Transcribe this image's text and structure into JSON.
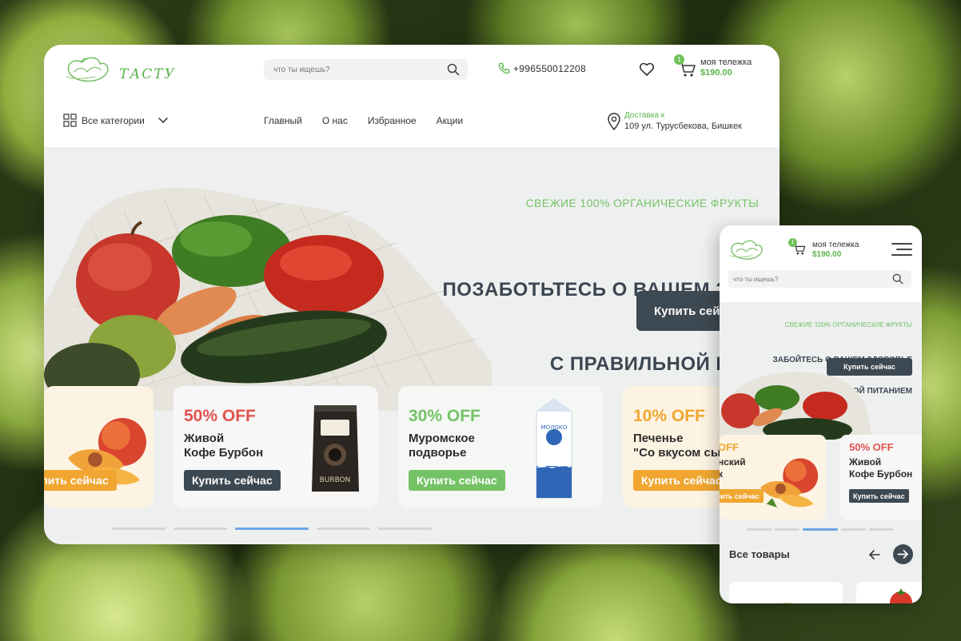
{
  "brand": {
    "name": "ТАСТУ"
  },
  "search": {
    "placeholder": "что ты ищешь?"
  },
  "contact": {
    "phone": "+996550012208"
  },
  "cart": {
    "title": "моя тележка",
    "total": "$190.00",
    "count": "1"
  },
  "categories": {
    "label": "Все категории"
  },
  "nav": [
    "Главный",
    "О нас",
    "Избранное",
    "Акции"
  ],
  "delivery": {
    "label": "Доставка к",
    "address": "109 ул. Турусбекова, Бишкек"
  },
  "hero": {
    "subtitle": "СВЕЖИЕ 100% ОРГАНИЧЕСКИЕ ФРУКТЫ",
    "title_line1": "ПОЗАБОТЬТЕСЬ О ВАШЕМ ЗДОРОВЬЕ",
    "title_line2": "С ПРАВИЛЬНОЙ ПИТАНИЕМ",
    "button": "Купить сейчас"
  },
  "promos": [
    {
      "percent": "",
      "name": "",
      "button": "Купить сейчас",
      "color": "#f0a630"
    },
    {
      "percent": "50% OFF",
      "name": "Живой\nКофе Бурбон",
      "button": "Купить сейчас",
      "color": "#e2534e",
      "btn_color": "#3d4952"
    },
    {
      "percent": "30% OFF",
      "name": "Муромское\nподворье",
      "button": "Купить сейчас",
      "color": "#74c266",
      "btn_color": "#74c266"
    },
    {
      "percent": "10% OFF",
      "name": "Печенье\n\"Со вкусом сыра\"",
      "button": "Купить сейчас",
      "color": "#f0a630",
      "btn_color": "#f0a630"
    }
  ],
  "carousel": {
    "active_index": 2,
    "count": 5
  },
  "mobile": {
    "hero_subtitle": "СВЕЖИЕ 100% ОРГАНИЧЕСКИЕ ФРУКТЫ",
    "hero_title_line1": "ЗАБОЙТЕСЬ О ВАШЕМ ЗДОРОВЬЕ",
    "hero_title_line2": "С ПРАВИЛЬНОЙ ПИТАНИЕМ",
    "hero_button": "Купить сейчас",
    "promo0": {
      "percent": "OFF",
      "name": "нский\nк",
      "button": "Купить сейчас"
    },
    "promo1": {
      "percent": "50% OFF",
      "name": "Живой\nКофе Бурбон",
      "button": "Купить сейчас"
    },
    "section_title": "Все товары"
  },
  "colors": {
    "accent_green": "#74c266",
    "dark": "#3d4952",
    "sale_red": "#e2534e",
    "orange": "#f0a630",
    "active_dot": "#6aa6e4"
  }
}
